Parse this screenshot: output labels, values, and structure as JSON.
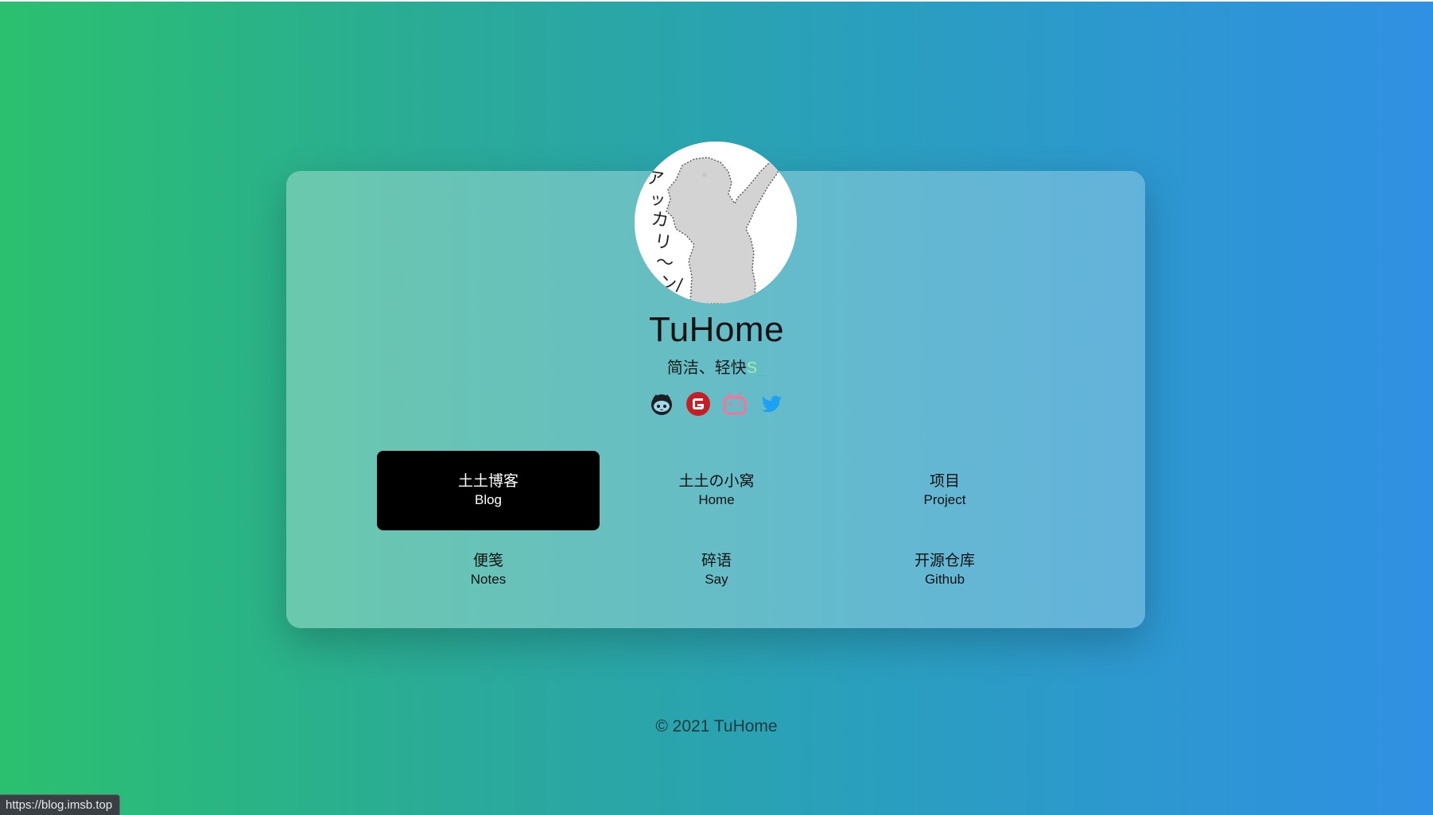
{
  "site": {
    "title": "TuHome",
    "subtitle": "简洁、轻快",
    "typing_char": "S",
    "typing_cursor": "_",
    "avatar_text": "アッカリ〜ン/"
  },
  "socials": [
    {
      "name": "github",
      "icon": "github-icon",
      "color": "#1b1f23"
    },
    {
      "name": "gitee",
      "icon": "gitee-icon",
      "color": "#c71d23"
    },
    {
      "name": "bilibili",
      "icon": "bilibili-icon",
      "color": "#fb7299"
    },
    {
      "name": "twitter",
      "icon": "twitter-icon",
      "color": "#1da1f2"
    }
  ],
  "nav": [
    {
      "zh": "土土博客",
      "en": "Blog",
      "active": true
    },
    {
      "zh": "土土の小窝",
      "en": "Home",
      "active": false
    },
    {
      "zh": "项目",
      "en": "Project",
      "active": false
    },
    {
      "zh": "便笺",
      "en": "Notes",
      "active": false
    },
    {
      "zh": "碎语",
      "en": "Say",
      "active": false
    },
    {
      "zh": "开源仓库",
      "en": "Github",
      "active": false
    }
  ],
  "footer": "© 2021 TuHome",
  "status_bar_url": "https://blog.imsb.top",
  "colors": {
    "gradient_start": "#2bc06f",
    "gradient_end": "#3090e3",
    "active_nav_bg": "#000000"
  }
}
